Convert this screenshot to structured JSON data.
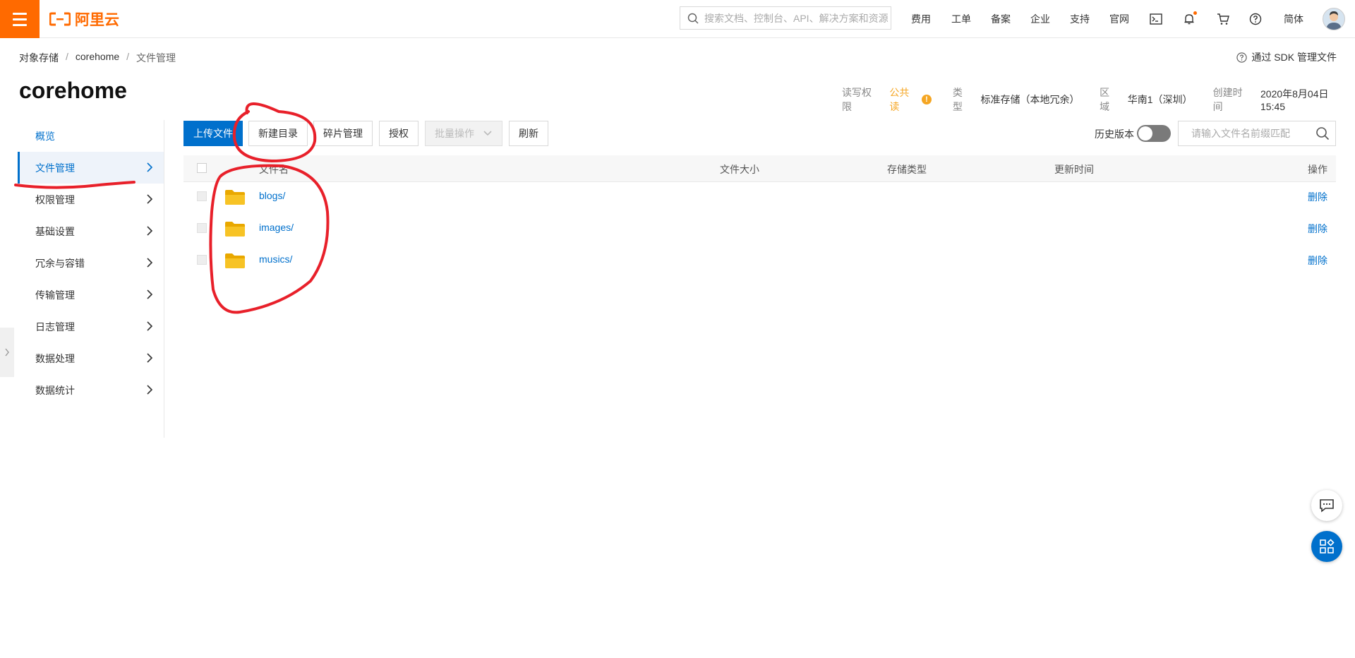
{
  "topbar": {
    "logo_text": "阿里云",
    "search_placeholder": "搜索文档、控制台、API、解决方案和资源",
    "nav": [
      "费用",
      "工单",
      "备案",
      "企业",
      "支持",
      "官网"
    ],
    "lang": "简体",
    "brand_color": "#ff6a00"
  },
  "breadcrumb": [
    "对象存储",
    "corehome",
    "文件管理"
  ],
  "sdk_link": "通过 SDK 管理文件",
  "bucket": {
    "name": "corehome",
    "acl_label": "读写权限",
    "acl_value": "公共读",
    "type_label": "类型",
    "type_value": "标准存储（本地冗余）",
    "region_label": "区域",
    "region_value": "华南1（深圳）",
    "created_label": "创建时间",
    "created_value": "2020年8月04日 15:45"
  },
  "sidebar": {
    "items": [
      {
        "label": "概览"
      },
      {
        "label": "文件管理"
      },
      {
        "label": "权限管理"
      },
      {
        "label": "基础设置"
      },
      {
        "label": "冗余与容错"
      },
      {
        "label": "传输管理"
      },
      {
        "label": "日志管理"
      },
      {
        "label": "数据处理"
      },
      {
        "label": "数据统计"
      }
    ],
    "active_color": "#0070cc"
  },
  "toolbar": {
    "upload": "上传文件",
    "new_dir": "新建目录",
    "fragments": "碎片管理",
    "authorize": "授权",
    "batch": "批量操作",
    "refresh": "刷新",
    "history_label": "历史版本",
    "filter_placeholder": "请输入文件名前缀匹配"
  },
  "table": {
    "columns": [
      "文件名",
      "文件大小",
      "存储类型",
      "更新时间",
      "操作"
    ],
    "rows": [
      {
        "name": "blogs/",
        "action": "删除"
      },
      {
        "name": "images/",
        "action": "删除"
      },
      {
        "name": "musics/",
        "action": "删除"
      }
    ]
  },
  "colors": {
    "primary": "#0070cc",
    "warning": "#f5a623",
    "annotation": "#e8202a",
    "folder": "#f7c325"
  }
}
